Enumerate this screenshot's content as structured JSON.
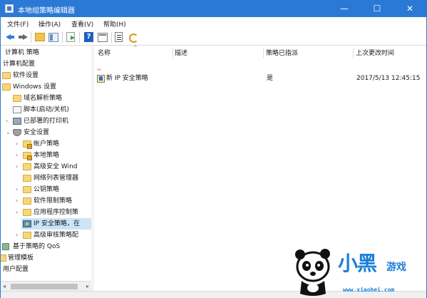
{
  "window": {
    "title": "本地组策略编辑器",
    "controls": {
      "minimize": "—",
      "maximize": "☐",
      "close": "✕"
    }
  },
  "menu": [
    "文件(F)",
    "操作(A)",
    "查看(V)",
    "帮助(H)"
  ],
  "tree": {
    "items": [
      {
        "label": "计算机 策略"
      },
      {
        "label": "计算机配置"
      },
      {
        "label": "软件设置"
      },
      {
        "label": "Windows 设置"
      },
      {
        "label": "域名解析策略"
      },
      {
        "label": "脚本(启动/关机)"
      },
      {
        "label": "已部署的打印机"
      },
      {
        "label": "安全设置"
      },
      {
        "label": "帐户策略"
      },
      {
        "label": "本地策略"
      },
      {
        "label": "高级安全 Wind"
      },
      {
        "label": "网络列表管理器"
      },
      {
        "label": "公钥策略"
      },
      {
        "label": "软件限制策略"
      },
      {
        "label": "应用程序控制策"
      },
      {
        "label": "IP 安全策略，在"
      },
      {
        "label": "高级审核策略配"
      },
      {
        "label": "基于策略的 QoS"
      },
      {
        "label": "管理模板"
      },
      {
        "label": "用户配置"
      }
    ]
  },
  "table": {
    "columns": [
      "名称",
      "描述",
      "策略已指派",
      "上次更改时间"
    ],
    "rows": [
      {
        "name": "新 IP 安全策略",
        "description": "",
        "assigned": "是",
        "modified": "2017/5/13 12:45:15"
      }
    ]
  },
  "watermark": {
    "brand_big": "小黑",
    "brand_small": "游戏",
    "url": "www.xiaohei.com",
    "color": "#1b7fd8"
  }
}
